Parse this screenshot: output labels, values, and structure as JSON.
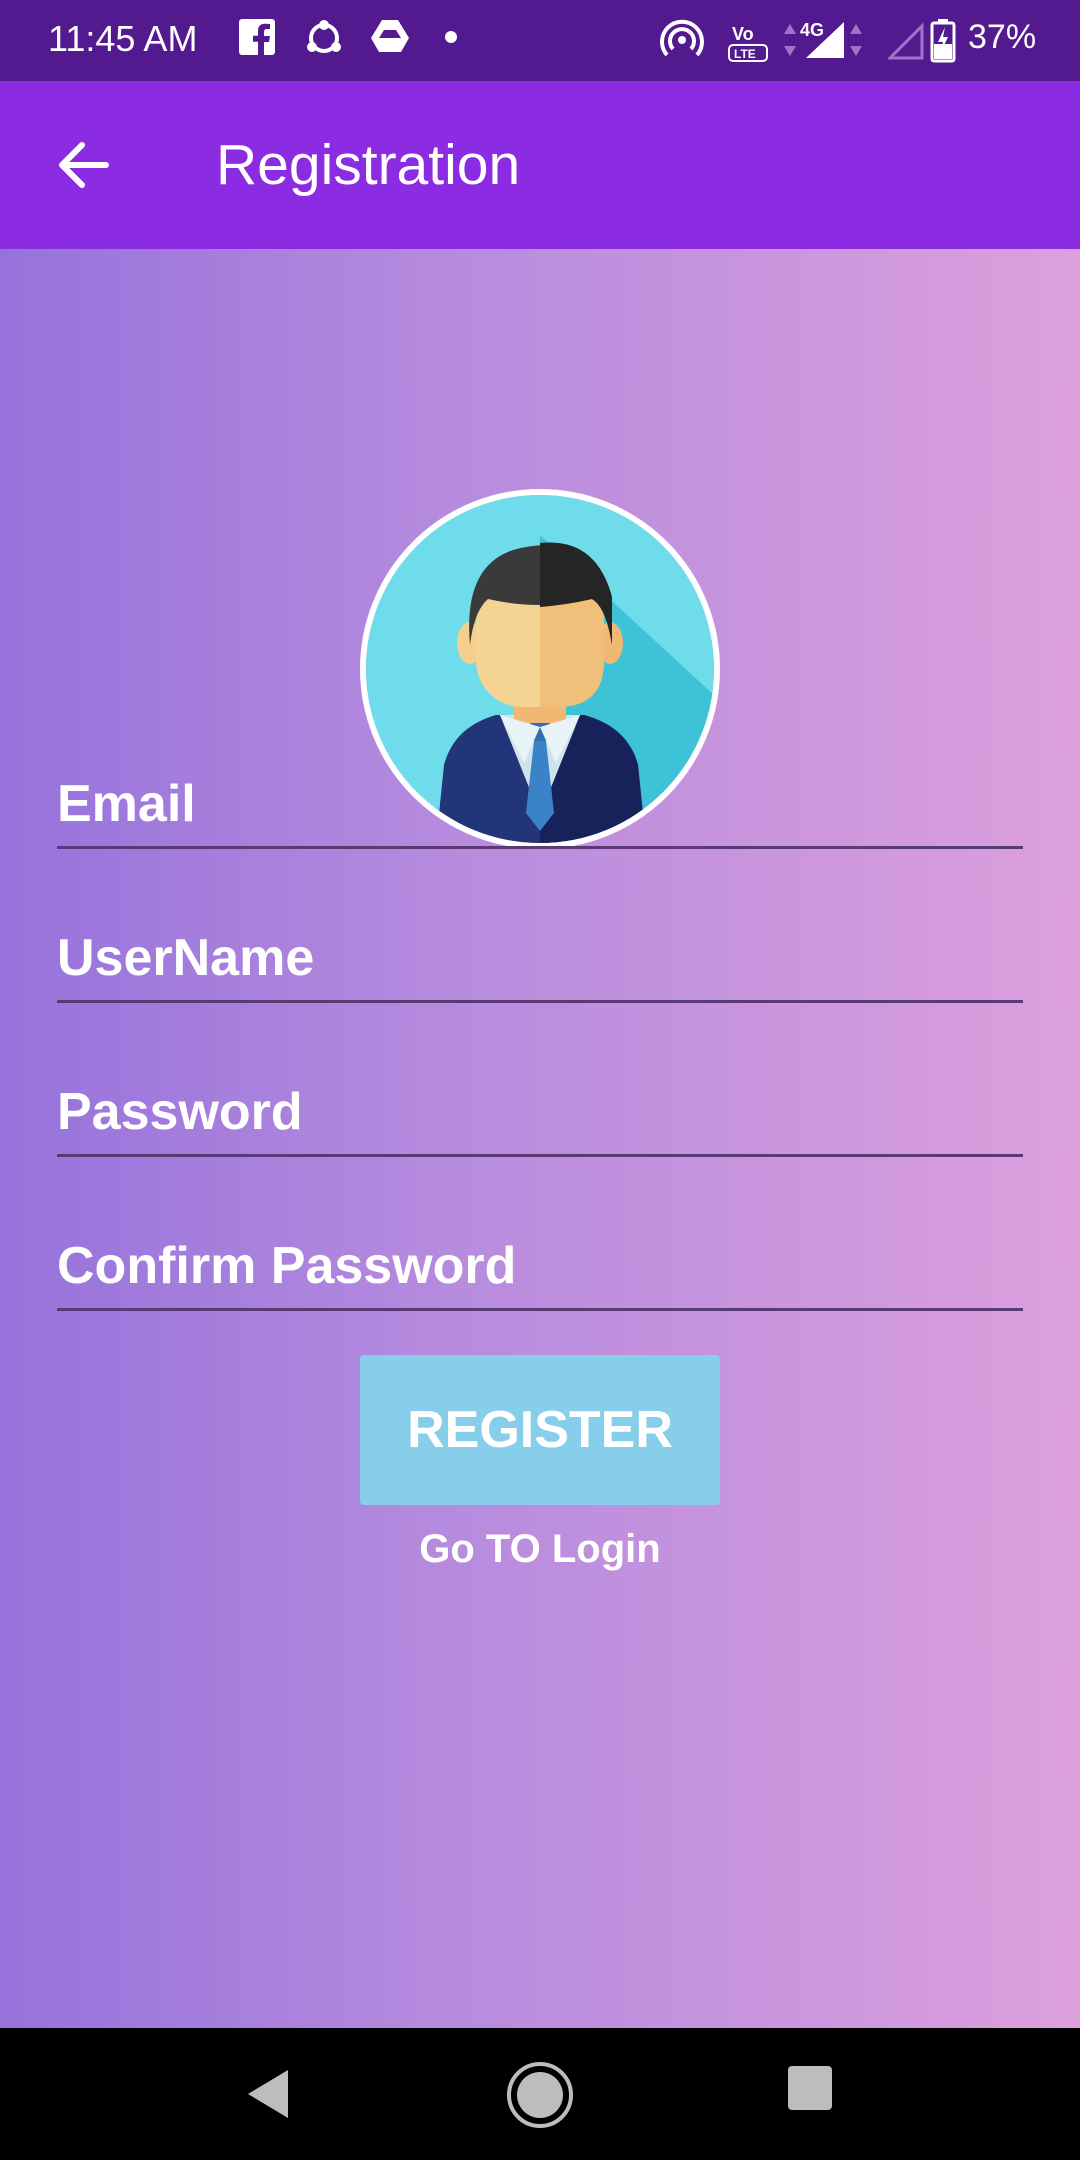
{
  "status_bar": {
    "time": "11:45 AM",
    "battery": "37%",
    "icons": [
      "facebook-icon",
      "share-icon",
      "drive-icon",
      "dot-icon",
      "hotspot-icon",
      "volte-icon",
      "signal-4g-icon",
      "signal-empty-icon",
      "battery-icon"
    ]
  },
  "app_bar": {
    "title": "Registration",
    "back_icon": "arrow-left-icon"
  },
  "avatar": {
    "icon": "user-avatar-icon"
  },
  "form": {
    "email_placeholder": "Email",
    "username_placeholder": "UserName",
    "password_placeholder": "Password",
    "confirm_password_placeholder": "Confirm Password",
    "register_label": "REGISTER",
    "goto_login": "Go TO Login"
  },
  "nav_bar": {
    "icons": [
      "back-triangle-icon",
      "home-circle-icon",
      "recents-square-icon"
    ]
  },
  "colors": {
    "status_bar": "#521a8e",
    "app_bar": "#8b2be2",
    "gradient_start": "#9672db",
    "gradient_end": "#dca0dd",
    "register_button": "#86cee9"
  }
}
